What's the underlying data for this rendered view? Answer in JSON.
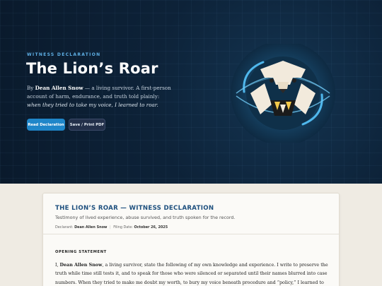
{
  "hero": {
    "eyebrow": "WITNESS DECLARATION",
    "title": "The Lion’s Roar",
    "desc_prefix": "By ",
    "author": "Dean Allen Snow",
    "desc_middle": " — a living survivor. A first-person account of harm, endurance, and truth told plainly: ",
    "desc_quote": "when they tried to take my voice, I learned to roar.",
    "primary_button": "Read Declaration",
    "secondary_button": "Save / Print PDF",
    "emblem_icon": "lion-emblem-icon",
    "colors": {
      "background": "#0d2238",
      "accent": "#1f86c9",
      "eyebrow": "#5fb0e6"
    }
  },
  "document": {
    "title": "THE LION’S ROAR — WITNESS DECLARATION",
    "subtitle": "Testimony of lived experience, abuse survived, and truth spoken for the record.",
    "declarant_label": "Declarant:",
    "declarant": "Dean Allen Snow",
    "filing_label": "Filing Date:",
    "filing_date": "October 26, 2025",
    "section_heading": "OPENING STATEMENT",
    "body_prefix": "I, ",
    "body_name": "Dean Allen Snow",
    "body_text": ", a living survivor, state the following of my own knowledge and experience. I write to preserve the truth while time still tests it, and to speak for those who were silenced or separated until their names blurred into case numbers. When they tried to make me doubt my worth, to bury my voice beneath procedure and “policy,” I learned to roar. This is that roar—",
    "colors": {
      "title": "#1d4f7e",
      "page_background": "#efebe3"
    }
  }
}
